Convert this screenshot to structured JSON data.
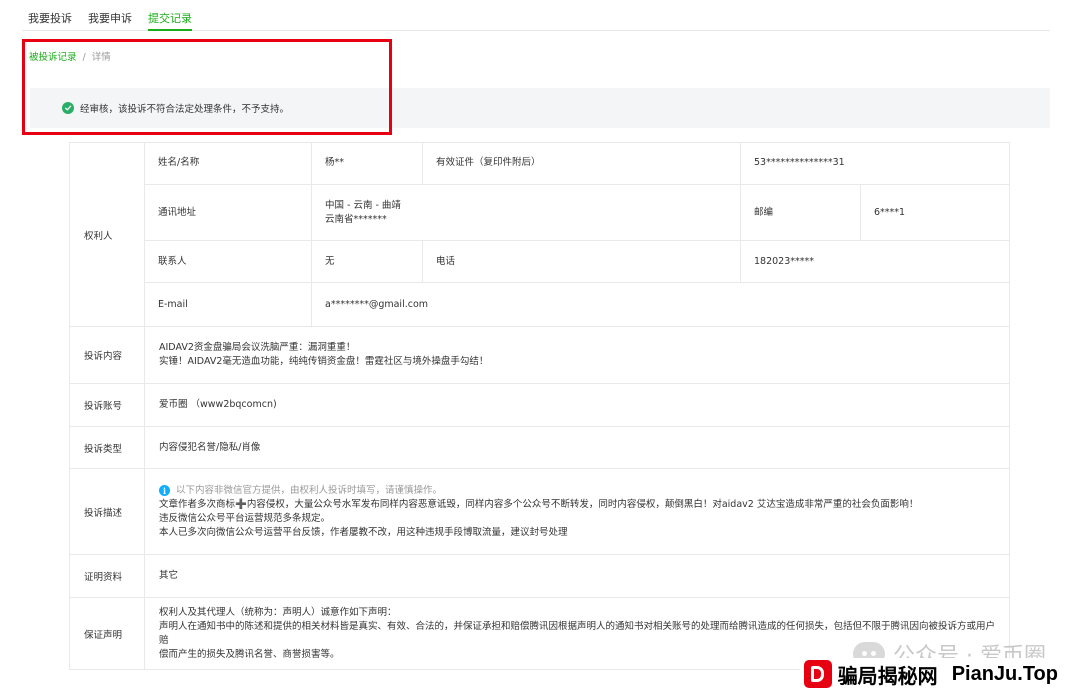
{
  "tabs": [
    {
      "label": "我要投诉"
    },
    {
      "label": "我要申诉"
    },
    {
      "label": "提交记录"
    }
  ],
  "breadcrumb": {
    "link": "被投诉记录",
    "separator": "/",
    "current": "详情"
  },
  "status": {
    "icon": "check-circle-icon",
    "text": "经审核，该投诉不符合法定处理条件，不予支持。"
  },
  "rights_holder": {
    "label": "权利人",
    "name_label": "姓名/名称",
    "name": "杨**",
    "id_label": "有效证件（复印件附后）",
    "id_value": "53**************31",
    "address_label": "通讯地址",
    "address_line1": "中国 - 云南 - 曲靖",
    "address_line2": "云南省*******",
    "postcode_label": "邮编",
    "postcode": "6****1",
    "contact_label": "联系人",
    "contact": "无",
    "phone_label": "电话",
    "phone": "182023*****",
    "email_label": "E-mail",
    "email": "a********@gmail.com"
  },
  "complaint_content": {
    "label": "投诉内容",
    "line1": "AIDAV2资金盘骗局会议洗脑严重：漏洞重重！",
    "line2": "实锤！AIDAV2毫无造血功能，纯纯传销资金盘！雷霆社区与境外操盘手勾结！"
  },
  "complaint_account": {
    "label": "投诉账号",
    "value": "爱币圈 （www2bqcomcn)"
  },
  "complaint_type": {
    "label": "投诉类型",
    "value": "内容侵犯名誉/隐私/肖像"
  },
  "complaint_description": {
    "label": "投诉描述",
    "notice_icon": "info-icon",
    "notice": "以下内容非微信官方提供，由权利人投诉时填写，请谨慎操作。",
    "line1": "文章作者多次商标➕内容侵权，大量公众号水军发布同样内容恶意诋毁，同样内容多个公众号不断转发，同时内容侵权，颠倒黑白！对aidav2 艾达宝造成非常严重的社会负面影响！",
    "line2": "违反微信公众号平台运营规范多条规定。",
    "line3": "本人已多次向微信公众号运营平台反馈，作者屡教不改，用这种违规手段博取流量，建议封号处理"
  },
  "evidence": {
    "label": "证明资料",
    "value": "其它"
  },
  "guarantee": {
    "label": "保证声明",
    "line1": "权利人及其代理人（统称为：声明人）诚意作如下声明：",
    "line2": "声明人在通知书中的陈述和提供的相关材料皆是真实、有效、合法的，并保证承担和赔偿腾讯因根据声明人的通知书对相关账号的处理而给腾讯造成的任何损失，包括但不限于腾讯因向被投诉方或用户赔",
    "line3": "偿而产生的损失及腾讯名誉、商誉损害等。"
  },
  "watermark": {
    "text": "公众号 · 爱币圈"
  },
  "brand": {
    "name_cn": "骗局揭秘网",
    "name_en": "PianJu.Top"
  },
  "colors": {
    "accent": "#1aad19",
    "highlight": "#e60012",
    "success": "#2aae67",
    "info": "#10aeff"
  }
}
